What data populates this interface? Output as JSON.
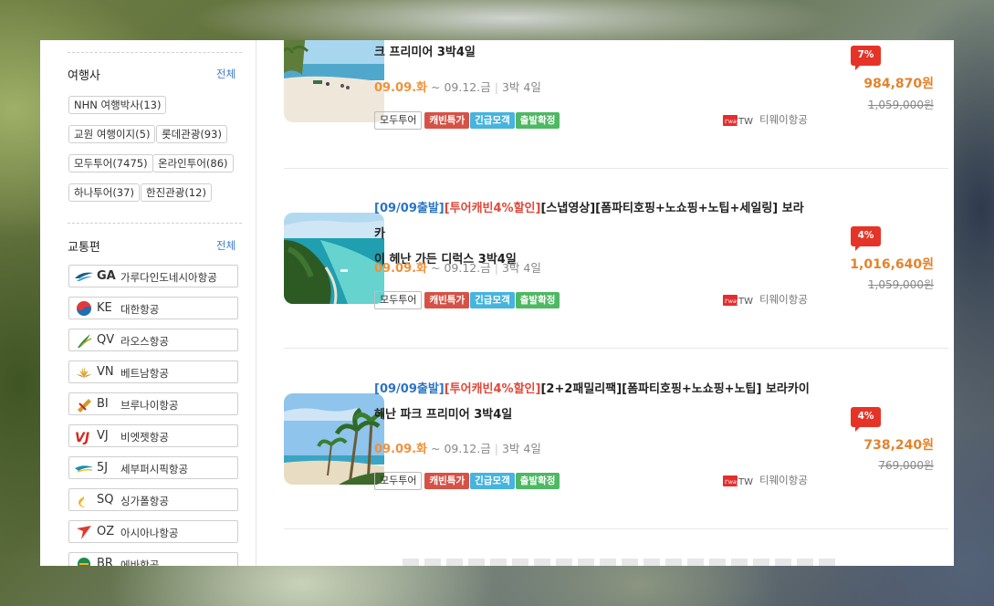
{
  "sidebar": {
    "agency_title": "여행사",
    "agency_all": "전체",
    "agencies": [
      "NHN 여행박사(13)",
      "교원 여행이지(5)",
      "롯데관광(93)",
      "모두투어(7475)",
      "온라인투어(86)",
      "하나투어(37)",
      "한진관광(12)"
    ],
    "transport_title": "교통편",
    "transport_all": "전체",
    "airlines": [
      {
        "code": "GA",
        "name": "가루다인도네시아항공",
        "icon": "garuda-logo-icon",
        "color": "#1c5c86"
      },
      {
        "code": "KE",
        "name": "대한항공",
        "icon": "korean-air-logo-icon",
        "color": "#1f6fb5"
      },
      {
        "code": "QV",
        "name": "라오스항공",
        "icon": "lao-airlines-logo-icon",
        "color": "#2d8f3a"
      },
      {
        "code": "VN",
        "name": "베트남항공",
        "icon": "vietnam-airlines-logo-icon",
        "color": "#d9a43a"
      },
      {
        "code": "BI",
        "name": "브루나이항공",
        "icon": "royal-brunei-logo-icon",
        "color": "#d39a26"
      },
      {
        "code": "VJ",
        "name": "비엣젯항공",
        "icon": "vietjet-logo-icon",
        "color": "#d7261e"
      },
      {
        "code": "5J",
        "name": "세부퍼시픽항공",
        "icon": "cebu-pacific-logo-icon",
        "color": "#1a8fb0"
      },
      {
        "code": "SQ",
        "name": "싱가폴항공",
        "icon": "singapore-airlines-logo-icon",
        "color": "#f0b323"
      },
      {
        "code": "OZ",
        "name": "아시아나항공",
        "icon": "asiana-logo-icon",
        "color": "#e03a2f"
      },
      {
        "code": "BR",
        "name": "에바항공",
        "icon": "eva-air-logo-icon",
        "color": "#1e8a4a"
      }
    ]
  },
  "products": [
    {
      "title_prefix_blue": "",
      "title_prefix_red": "",
      "title_line1": "크 프리미어 3박4일",
      "title_line2": "",
      "start": "09.09.화",
      "end": "~ 09.12.금",
      "duration": "3박 4일",
      "agency": "모두투어",
      "badges": [
        "캐빈특가",
        "긴급모객",
        "출발확정"
      ],
      "airline_label": "티웨이항공",
      "airline_logo_text": "TW",
      "discount": "7%",
      "price": "984,870원",
      "original_price": "1,059,000원"
    },
    {
      "title_prefix_blue": "[09/09출발]",
      "title_prefix_red": "[투어캐빈4%할인]",
      "title_line1": "[스냅영상][폼파티호핑+노쇼핑+노팁+세일링] 보라카",
      "title_line2": "이 헤난 가든 디럭스 3박4일",
      "start": "09.09.화",
      "end": "~ 09.12.금",
      "duration": "3박 4일",
      "agency": "모두투어",
      "badges": [
        "캐빈특가",
        "긴급모객",
        "출발확정"
      ],
      "airline_label": "티웨이항공",
      "airline_logo_text": "TW",
      "discount": "4%",
      "price": "1,016,640원",
      "original_price": "1,059,000원"
    },
    {
      "title_prefix_blue": "[09/09출발]",
      "title_prefix_red": "[투어캐빈4%할인]",
      "title_line1": "[2+2패밀리팩][폼파티호핑+노쇼핑+노팁] 보라카이",
      "title_line2": "헤난 파크 프리미어 3박4일",
      "start": "09.09.화",
      "end": "~ 09.12.금",
      "duration": "3박 4일",
      "agency": "모두투어",
      "badges": [
        "캐빈특가",
        "긴급모객",
        "출발확정"
      ],
      "airline_label": "티웨이항공",
      "airline_logo_text": "TW",
      "discount": "4%",
      "price": "738,240원",
      "original_price": "769,000원"
    }
  ],
  "colors": {
    "accent_blue": "#2c74c4",
    "accent_red": "#e0483a",
    "price_orange": "#e2832e",
    "discount_red": "#e53427"
  }
}
